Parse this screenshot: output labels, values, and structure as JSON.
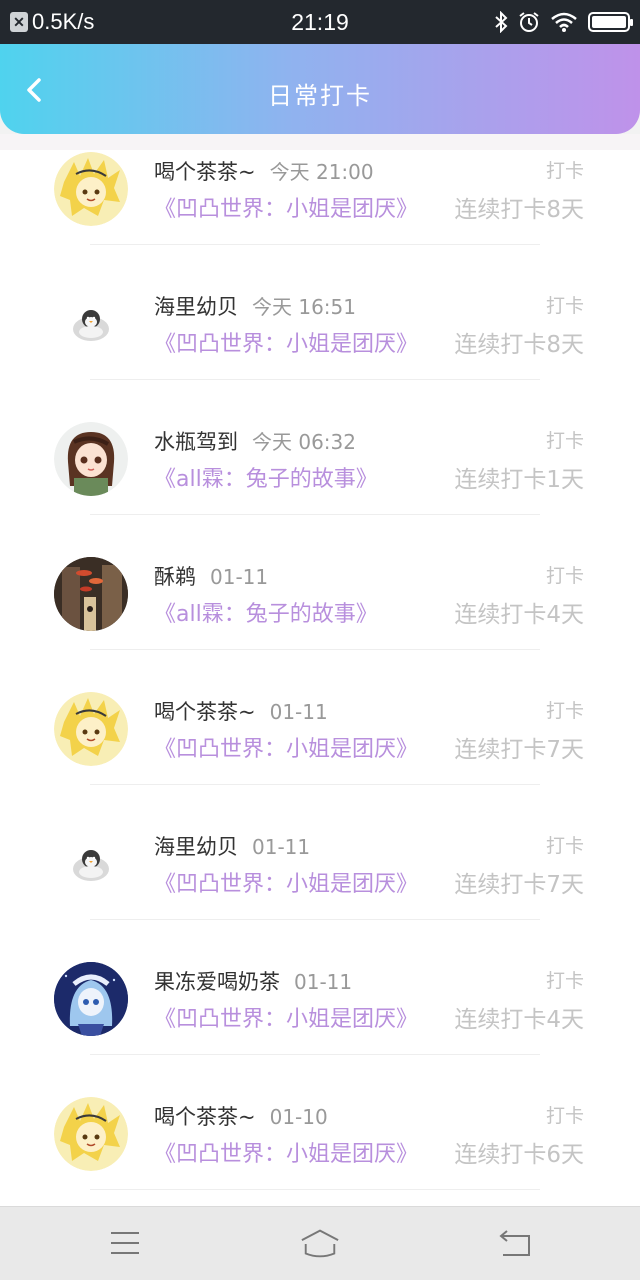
{
  "status_bar": {
    "speed": "0.5K/s",
    "time": "21:19",
    "icons": [
      "app-x-icon",
      "bluetooth-icon",
      "alarm-icon",
      "wifi-icon",
      "battery-icon"
    ]
  },
  "header": {
    "title": "日常打卡",
    "back_icon": "chevron-left-icon"
  },
  "entries": [
    {
      "user": "喝个茶茶~",
      "time": "今天 21:00",
      "book": "《凹凸世界：小姐是团厌》",
      "action": "打卡",
      "streak": "连续打卡8天",
      "avatar": "avatar-anime-yellow"
    },
    {
      "user": "海里幼贝",
      "time": "今天 16:51",
      "book": "《凹凸世界：小姐是团厌》",
      "action": "打卡",
      "streak": "连续打卡8天",
      "avatar": "avatar-penguin"
    },
    {
      "user": "水瓶驾到",
      "time": "今天 06:32",
      "book": "《all霖：兔子的故事》",
      "action": "打卡",
      "streak": "连续打卡1天",
      "avatar": "avatar-chibi-girl"
    },
    {
      "user": "酥鹈",
      "time": "01-11",
      "book": "《all霖：兔子的故事》",
      "action": "打卡",
      "streak": "连续打卡4天",
      "avatar": "avatar-street-lanterns"
    },
    {
      "user": "喝个茶茶~",
      "time": "01-11",
      "book": "《凹凸世界：小姐是团厌》",
      "action": "打卡",
      "streak": "连续打卡7天",
      "avatar": "avatar-anime-yellow"
    },
    {
      "user": "海里幼贝",
      "time": "01-11",
      "book": "《凹凸世界：小姐是团厌》",
      "action": "打卡",
      "streak": "连续打卡7天",
      "avatar": "avatar-penguin"
    },
    {
      "user": "果冻爱喝奶茶",
      "time": "01-11",
      "book": "《凹凸世界：小姐是团厌》",
      "action": "打卡",
      "streak": "连续打卡4天",
      "avatar": "avatar-blue-anime"
    },
    {
      "user": "喝个茶茶~",
      "time": "01-10",
      "book": "《凹凸世界：小姐是团厌》",
      "action": "打卡",
      "streak": "连续打卡6天",
      "avatar": "avatar-anime-yellow"
    }
  ],
  "nav_bar": {
    "icons": [
      "menu-icon",
      "home-icon",
      "back-icon"
    ]
  },
  "colors": {
    "header_gradient": [
      "#4fd3ee",
      "#8fb3ef",
      "#bf92ea"
    ],
    "book_title": "#b88fdd",
    "muted": "#c4c4c4"
  }
}
